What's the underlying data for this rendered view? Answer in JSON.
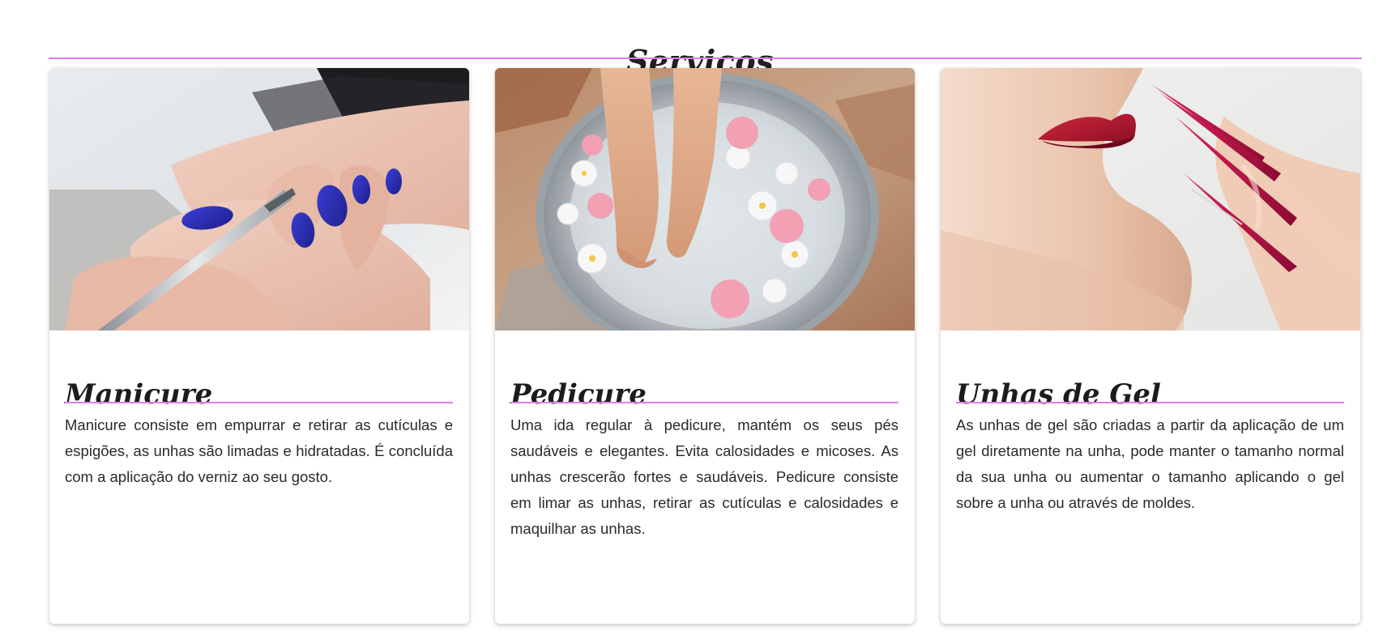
{
  "section": {
    "title": "Serviços"
  },
  "colors": {
    "accent": "#e27af0",
    "text": "#2a2a2a",
    "card_background": "#ffffff"
  },
  "cards": [
    {
      "title": "Manicure",
      "image": "manicure-photo",
      "text": "Manicure consiste em empurrar e retirar as cutículas e espigões, as unhas são limadas e hidratadas. É concluída com a aplicação do verniz ao seu gosto."
    },
    {
      "title": "Pedicure",
      "image": "pedicure-photo",
      "text": "Uma ida regular à pedicure, mantém os seus pés saudáveis e elegantes. Evita calosidades e micoses. As unhas crescerão fortes e saudáveis. Pedicure consiste em limar as unhas, retirar as cutículas e calosidades e maquilhar as unhas."
    },
    {
      "title": "Unhas de Gel",
      "image": "gel-nails-photo",
      "text": "As unhas de gel são criadas a partir da aplicação de um gel diretamente na unha, pode manter o tamanho normal da sua unha ou aumentar o tamanho aplicando o gel sobre a unha ou através de moldes."
    }
  ]
}
